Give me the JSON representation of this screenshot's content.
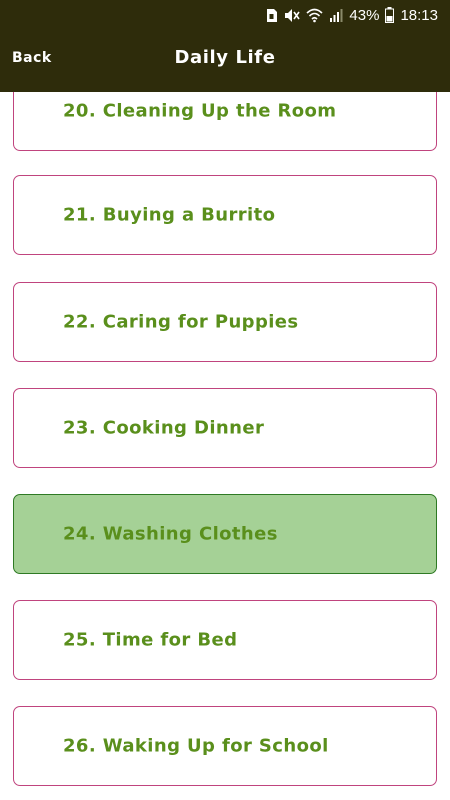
{
  "status_bar": {
    "battery_percent": "43%",
    "time": "18:13",
    "icons": [
      "sim-card-icon",
      "mute-icon",
      "wifi-icon",
      "signal-icon",
      "battery-icon"
    ]
  },
  "header": {
    "back_label": "Back",
    "title": "Daily Life"
  },
  "list": {
    "items": [
      {
        "label": "20. Cleaning Up the Room",
        "selected": false
      },
      {
        "label": "21. Buying a Burrito",
        "selected": false
      },
      {
        "label": "22. Caring for Puppies",
        "selected": false
      },
      {
        "label": "23. Cooking Dinner",
        "selected": false
      },
      {
        "label": "24. Washing Clothes",
        "selected": true
      },
      {
        "label": "25. Time for Bed",
        "selected": false
      },
      {
        "label": "26. Waking Up for School",
        "selected": false
      }
    ]
  },
  "colors": {
    "header_bg": "#2e2c0b",
    "item_border": "#c0447e",
    "item_text": "#5a8f1c",
    "selected_bg": "#a5d196",
    "selected_border": "#2e7a24"
  }
}
